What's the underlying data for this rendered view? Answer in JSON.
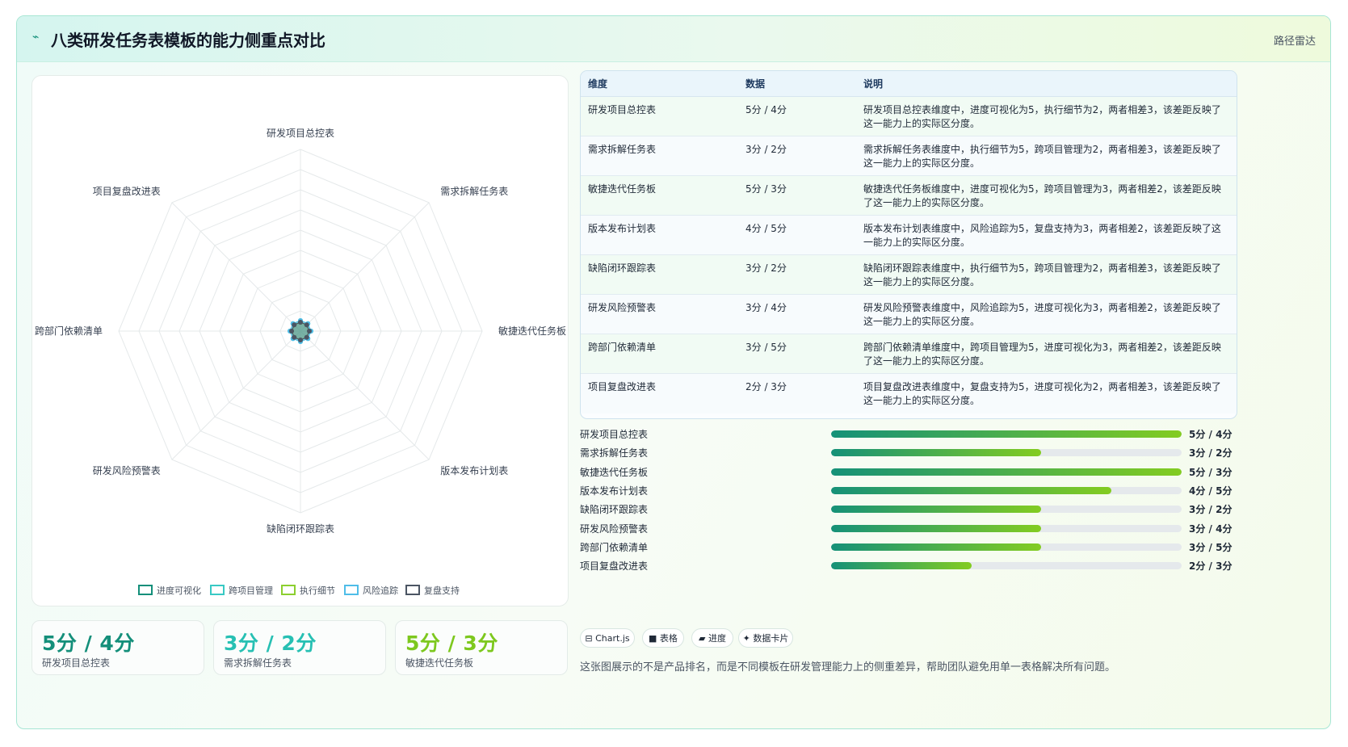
{
  "header": {
    "logo_icon": "pulse-icon",
    "title": "八类研发任务表模板的能力侧重点对比",
    "tag": "路径雷达"
  },
  "chart_data": {
    "type": "radar",
    "axes": [
      "研发项目总控表",
      "需求拆解任务表",
      "敏捷迭代任务板",
      "版本发布计划表",
      "缺陷闭环跟踪表",
      "研发风险预警表",
      "跨部门依赖清单",
      "项目复盘改进表"
    ],
    "scale_max": 5,
    "grid_levels": 9,
    "legend": [
      {
        "name": "进度可视化",
        "color": "#148f7a"
      },
      {
        "name": "跨项目管理",
        "color": "#38c9c4"
      },
      {
        "name": "执行细节",
        "color": "#8ccf2f"
      },
      {
        "name": "风险追踪",
        "color": "#4fbde8"
      },
      {
        "name": "复盘支持",
        "color": "#4b5563"
      }
    ],
    "legend_position": "bottom"
  },
  "kpis": [
    {
      "value": "5分 / 4分",
      "label": "研发项目总控表",
      "color": "#148f7a"
    },
    {
      "value": "3分 / 2分",
      "label": "需求拆解任务表",
      "color": "#27c0b3"
    },
    {
      "value": "5分 / 3分",
      "label": "敏捷迭代任务板",
      "color": "#7dc81e"
    }
  ],
  "table": {
    "headers": [
      "维度",
      "数据",
      "说明"
    ],
    "rows": [
      {
        "dim": "研发项目总控表",
        "data": "5分 / 4分",
        "desc": "研发项目总控表维度中，进度可视化为5，执行细节为2，两者相差3，该差距反映了这一能力上的实际区分度。"
      },
      {
        "dim": "需求拆解任务表",
        "data": "3分 / 2分",
        "desc": "需求拆解任务表维度中，执行细节为5，跨项目管理为2，两者相差3，该差距反映了这一能力上的实际区分度。"
      },
      {
        "dim": "敏捷迭代任务板",
        "data": "5分 / 3分",
        "desc": "敏捷迭代任务板维度中，进度可视化为5，跨项目管理为3，两者相差2，该差距反映了这一能力上的实际区分度。"
      },
      {
        "dim": "版本发布计划表",
        "data": "4分 / 5分",
        "desc": "版本发布计划表维度中，风险追踪为5，复盘支持为3，两者相差2，该差距反映了这一能力上的实际区分度。"
      },
      {
        "dim": "缺陷闭环跟踪表",
        "data": "3分 / 2分",
        "desc": "缺陷闭环跟踪表维度中，执行细节为5，跨项目管理为2，两者相差3，该差距反映了这一能力上的实际区分度。"
      },
      {
        "dim": "研发风险预警表",
        "data": "3分 / 4分",
        "desc": "研发风险预警表维度中，风险追踪为5，进度可视化为3，两者相差2，该差距反映了这一能力上的实际区分度。"
      },
      {
        "dim": "跨部门依赖清单",
        "data": "3分 / 5分",
        "desc": "跨部门依赖清单维度中，跨项目管理为5，进度可视化为3，两者相差2，该差距反映了这一能力上的实际区分度。"
      },
      {
        "dim": "项目复盘改进表",
        "data": "2分 / 3分",
        "desc": "项目复盘改进表维度中，复盘支持为5，进度可视化为2，两者相差3，该差距反映了这一能力上的实际区分度。"
      }
    ]
  },
  "progress": [
    {
      "label": "研发项目总控表",
      "value_text": "5分 / 4分",
      "fraction": 1.0
    },
    {
      "label": "需求拆解任务表",
      "value_text": "3分 / 2分",
      "fraction": 0.6
    },
    {
      "label": "敏捷迭代任务板",
      "value_text": "5分 / 3分",
      "fraction": 1.0
    },
    {
      "label": "版本发布计划表",
      "value_text": "4分 / 5分",
      "fraction": 0.8
    },
    {
      "label": "缺陷闭环跟踪表",
      "value_text": "3分 / 2分",
      "fraction": 0.6
    },
    {
      "label": "研发风险预警表",
      "value_text": "3分 / 4分",
      "fraction": 0.6
    },
    {
      "label": "跨部门依赖清单",
      "value_text": "3分 / 5分",
      "fraction": 0.6
    },
    {
      "label": "项目复盘改进表",
      "value_text": "2分 / 3分",
      "fraction": 0.4
    }
  ],
  "chips": [
    {
      "icon": "table-icon",
      "label": "⊟ Chart.js"
    },
    {
      "icon": "square-icon",
      "label": "■ 表格"
    },
    {
      "icon": "progress-icon",
      "label": "▰ 进度"
    },
    {
      "icon": "sparkle-icon",
      "label": "✦ 数据卡片"
    }
  ],
  "note": "这张图展示的不是产品排名，而是不同模板在研发管理能力上的侧重差异，帮助团队避免用单一表格解决所有问题。"
}
